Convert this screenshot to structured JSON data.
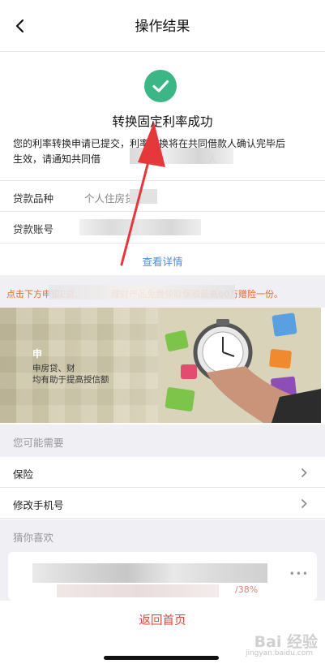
{
  "nav": {
    "title": "操作结果"
  },
  "result": {
    "title": "转换固定利率成功",
    "description_line1": "您的利率转换申请已提交，利率转换将在共同借款人确认完毕后",
    "description_line2": "生效，请通知共同借",
    "description_tail": "人"
  },
  "info": [
    {
      "label": "贷款品种",
      "value": "个人住房贷款"
    },
    {
      "label": "贷款账号",
      "value": ""
    }
  ],
  "detail_link": "查看详情",
  "promo": {
    "text_left": "点击下方申银E贷、",
    "text_right": "理财产品免费领取保额最高60万赠险一份。"
  },
  "banner": {
    "head": "申",
    "sub_line1": "申房贷、财",
    "sub_line2": "均有助于提高授信额"
  },
  "section_maybe": "您可能需要",
  "menu": [
    {
      "label": "保险"
    },
    {
      "label": "修改手机号"
    }
  ],
  "section_guess": "猜你喜欢",
  "product": {
    "rate": "/38%",
    "more": "•••"
  },
  "home_button": "返回首页",
  "watermark": {
    "text": "Bai 经验",
    "url": "jingyan.baidu.com"
  },
  "colors": {
    "success": "#3cb685",
    "link": "#4a8fd6",
    "promo": "#e8692a",
    "danger": "#e2463e",
    "arrow": "#e5383b"
  }
}
